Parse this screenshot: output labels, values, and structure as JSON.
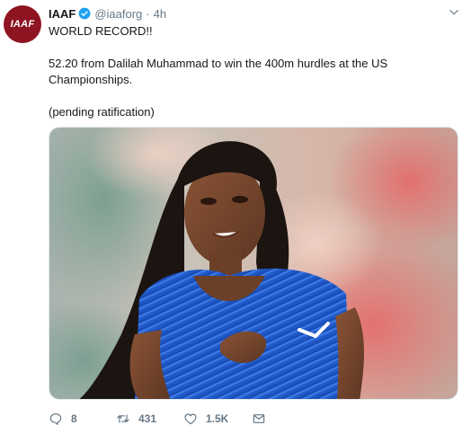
{
  "tweet": {
    "author_name": "IAAF",
    "author_handle": "@iaaforg",
    "separator": "·",
    "timestamp": "4h",
    "avatar_text": "IAAF",
    "line1": "WORLD RECORD!!",
    "line2": "52.20 from Dalilah Muhammad to win the 400m hurdles at the US Championships.",
    "line3": "(pending ratification)"
  },
  "actions": {
    "reply_count": "8",
    "retweet_count": "431",
    "like_count": "1.5K"
  },
  "icons": {
    "verified": "verified-badge-icon",
    "menu": "chevron-down-icon",
    "reply": "reply-icon",
    "retweet": "retweet-icon",
    "like": "heart-icon",
    "dm": "envelope-icon"
  },
  "colors": {
    "accent": "#1da1f2",
    "avatar_bg": "#8f1422",
    "muted": "#657786",
    "jersey": "#1f5fd0"
  }
}
